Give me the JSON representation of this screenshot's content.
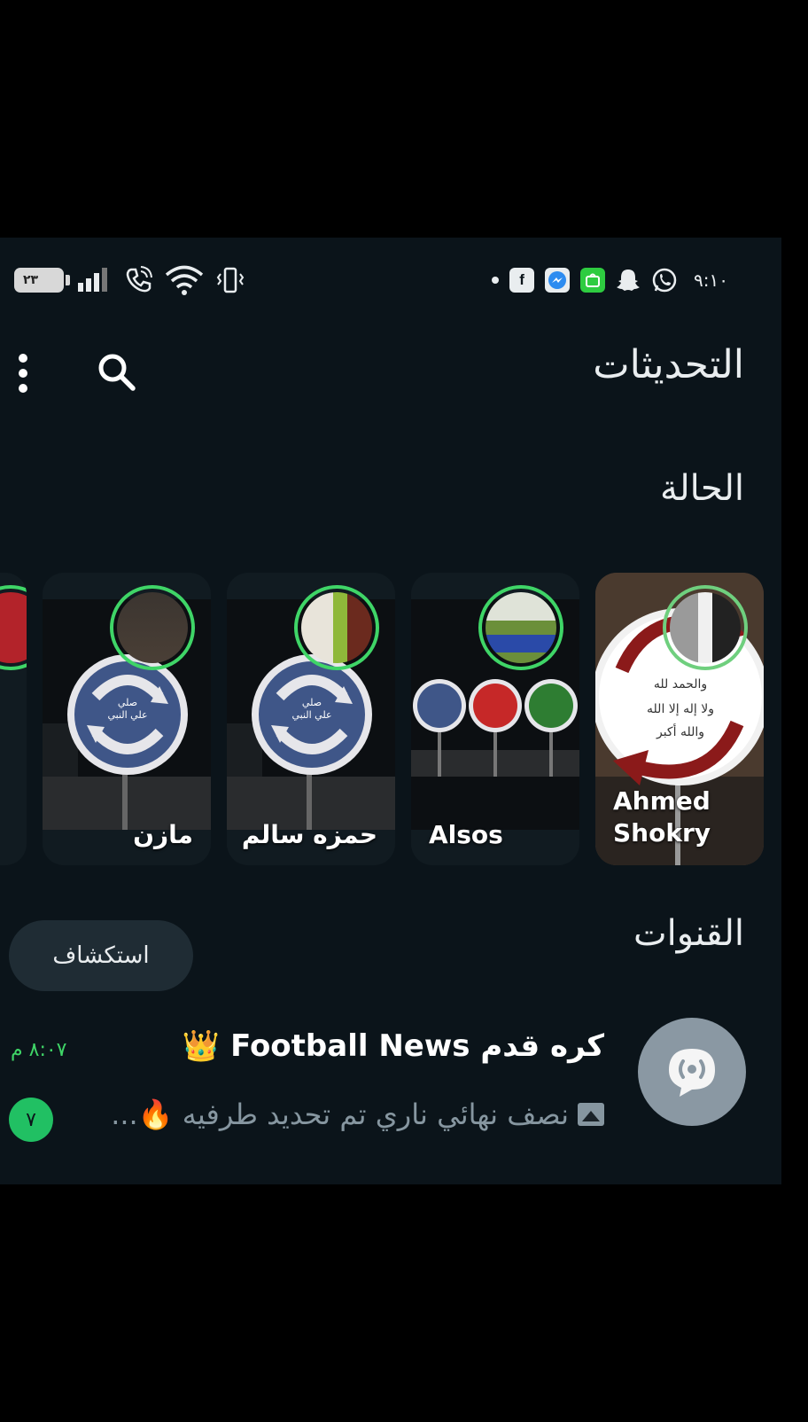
{
  "status_bar": {
    "battery": "٢٣",
    "time": "٩:١٠",
    "icons": [
      "signal-icon",
      "wifi-call-icon",
      "wifi-icon",
      "vibrate-icon",
      "facebook-icon",
      "messenger-icon",
      "store-icon",
      "snapchat-icon",
      "whatsapp-icon"
    ]
  },
  "header": {
    "title": "التحديثات",
    "search_icon": "search-icon",
    "menu_icon": "more-vert-icon"
  },
  "status_section": {
    "title": "الحالة",
    "items": [
      {
        "name": "Ahmed Shokry"
      },
      {
        "name": "Alsos"
      },
      {
        "name": "حمزه سالم"
      },
      {
        "name": "مازن"
      }
    ],
    "sign_text": [
      "صلي",
      "علي النبي"
    ]
  },
  "channels_section": {
    "title": "القنوات",
    "explore_label": "استكشاف",
    "channels": [
      {
        "name": "كره قدم Football News 👑",
        "time": "٨:٠٧ م",
        "preview": "نصف نهائي ناري تم تحديد طرفيه 🔥...",
        "unread": "٧"
      }
    ]
  },
  "colors": {
    "background": "#0b141a",
    "accent": "#3fd567",
    "badge": "#21c063"
  }
}
